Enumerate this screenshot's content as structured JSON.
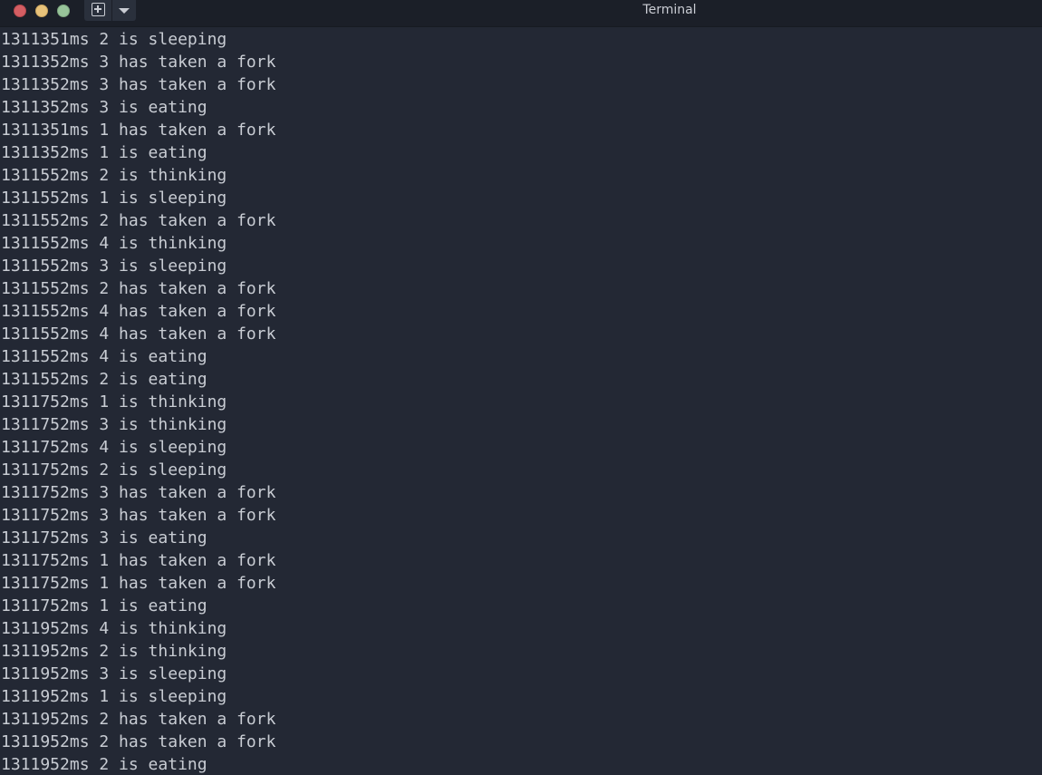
{
  "window": {
    "title": "Terminal"
  },
  "colors": {
    "background": "#232834",
    "titlebar": "#1b1f28",
    "text": "#c8ccd3",
    "close": "#d45e63",
    "minimize": "#e8c27a",
    "maximize": "#98c49a"
  },
  "icons": {
    "new_tab": "plus-square-icon",
    "tab_menu": "chevron-down-icon"
  },
  "terminal": {
    "lines": [
      "1311351ms 2 is sleeping",
      "1311352ms 3 has taken a fork",
      "1311352ms 3 has taken a fork",
      "1311352ms 3 is eating",
      "1311351ms 1 has taken a fork",
      "1311352ms 1 is eating",
      "1311552ms 2 is thinking",
      "1311552ms 1 is sleeping",
      "1311552ms 2 has taken a fork",
      "1311552ms 4 is thinking",
      "1311552ms 3 is sleeping",
      "1311552ms 2 has taken a fork",
      "1311552ms 4 has taken a fork",
      "1311552ms 4 has taken a fork",
      "1311552ms 4 is eating",
      "1311552ms 2 is eating",
      "1311752ms 1 is thinking",
      "1311752ms 3 is thinking",
      "1311752ms 4 is sleeping",
      "1311752ms 2 is sleeping",
      "1311752ms 3 has taken a fork",
      "1311752ms 3 has taken a fork",
      "1311752ms 3 is eating",
      "1311752ms 1 has taken a fork",
      "1311752ms 1 has taken a fork",
      "1311752ms 1 is eating",
      "1311952ms 4 is thinking",
      "1311952ms 2 is thinking",
      "1311952ms 3 is sleeping",
      "1311952ms 1 is sleeping",
      "1311952ms 2 has taken a fork",
      "1311952ms 2 has taken a fork",
      "1311952ms 2 is eating"
    ]
  }
}
